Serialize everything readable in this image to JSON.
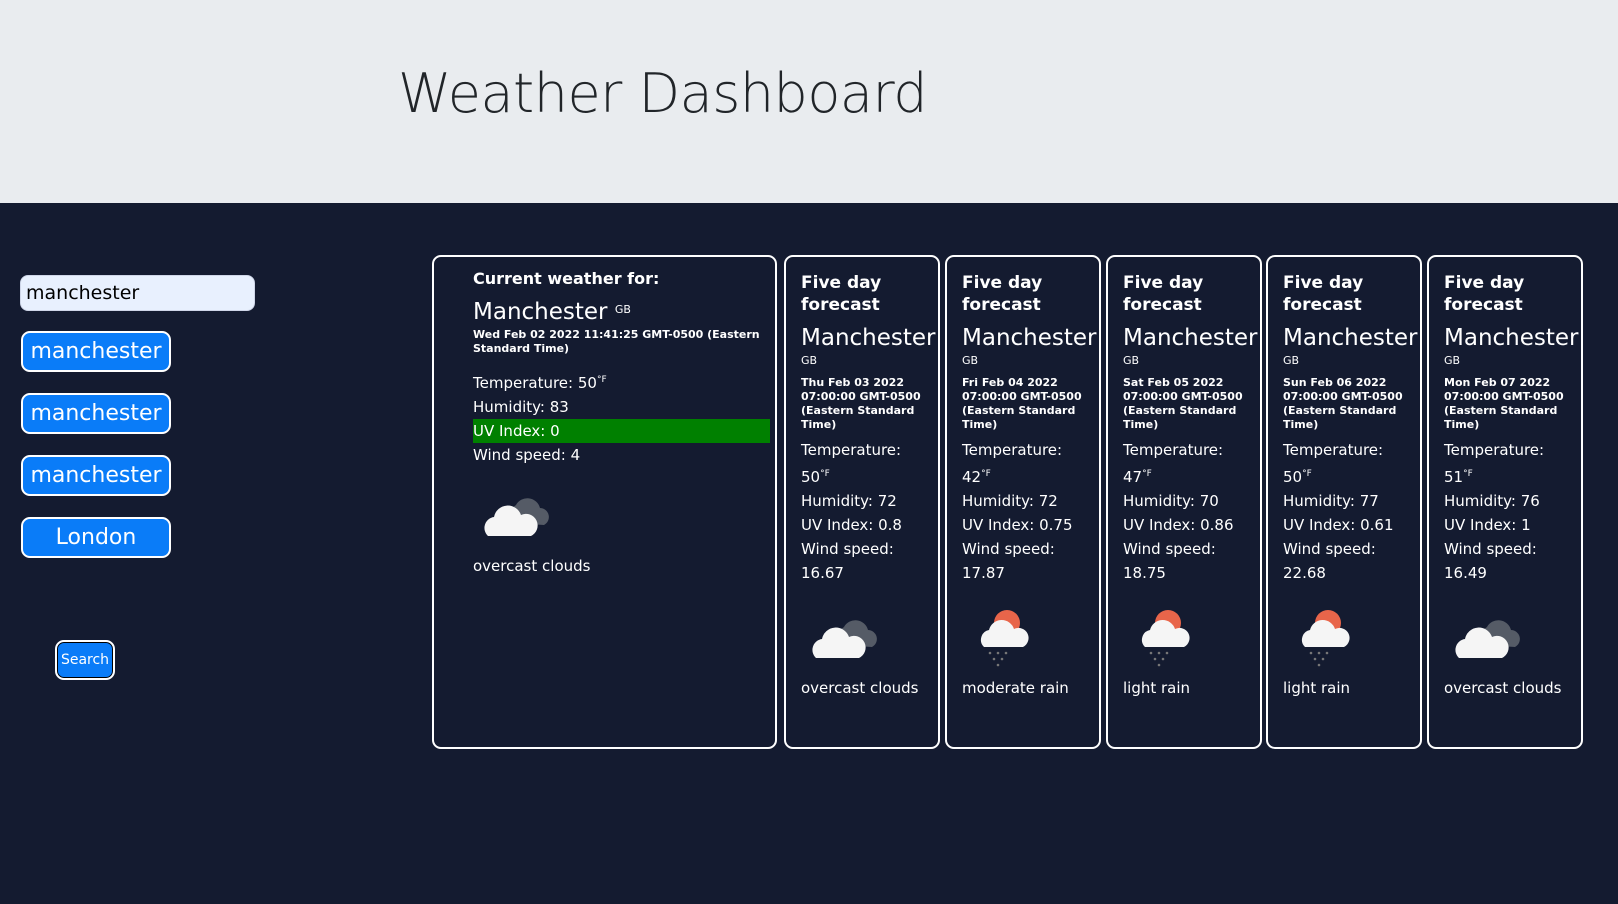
{
  "header": {
    "title": "Weather Dashboard"
  },
  "search": {
    "value": "manchester",
    "button_label": "Search"
  },
  "history": [
    "manchester",
    "manchester",
    "manchester",
    "London"
  ],
  "current": {
    "heading": "Current weather for:",
    "city": "Manchester",
    "country": "GB",
    "date": "Wed Feb 02 2022 11:41:25 GMT-0500 (Eastern Standard Time)",
    "temperature_label": "Temperature: 50",
    "temperature_unit": "°F",
    "humidity": "Humidity: 83",
    "uv": "UV Index: 0",
    "uv_color": "#008000",
    "wind": "Wind speed: 4",
    "icon": "overcast-clouds-icon",
    "description": "overcast clouds"
  },
  "forecast": [
    {
      "heading": "Five day forecast",
      "city": "Manchester",
      "country": "GB",
      "date": "Thu Feb 03 2022 07:00:00 GMT-0500 (Eastern Standard Time)",
      "temperature_label": "Temperature:",
      "temperature_value": "50",
      "temperature_unit": "°F",
      "humidity": "Humidity: 72",
      "uv": "UV Index: 0.8",
      "wind_label": "Wind speed:",
      "wind_value": "16.67",
      "icon": "overcast-clouds-icon",
      "description": "overcast clouds"
    },
    {
      "heading": "Five day forecast",
      "city": "Manchester",
      "country": "GB",
      "date": "Fri Feb 04 2022 07:00:00 GMT-0500 (Eastern Standard Time)",
      "temperature_label": "Temperature:",
      "temperature_value": "42",
      "temperature_unit": "°F",
      "humidity": "Humidity: 72",
      "uv": "UV Index: 0.75",
      "wind_label": "Wind speed:",
      "wind_value": "17.87",
      "icon": "rain-icon",
      "description": "moderate rain"
    },
    {
      "heading": "Five day forecast",
      "city": "Manchester",
      "country": "GB",
      "date": "Sat Feb 05 2022 07:00:00 GMT-0500 (Eastern Standard Time)",
      "temperature_label": "Temperature:",
      "temperature_value": "47",
      "temperature_unit": "°F",
      "humidity": "Humidity: 70",
      "uv": "UV Index: 0.86",
      "wind_label": "Wind speed:",
      "wind_value": "18.75",
      "icon": "rain-icon",
      "description": "light rain"
    },
    {
      "heading": "Five day forecast",
      "city": "Manchester",
      "country": "GB",
      "date": "Sun Feb 06 2022 07:00:00 GMT-0500 (Eastern Standard Time)",
      "temperature_label": "Temperature:",
      "temperature_value": "50",
      "temperature_unit": "°F",
      "humidity": "Humidity: 77",
      "uv": "UV Index: 0.61",
      "wind_label": "Wind speed:",
      "wind_value": "22.68",
      "icon": "rain-icon",
      "description": "light rain"
    },
    {
      "heading": "Five day forecast",
      "city": "Manchester",
      "country": "GB",
      "date": "Mon Feb 07 2022 07:00:00 GMT-0500 (Eastern Standard Time)",
      "temperature_label": "Temperature:",
      "temperature_value": "51",
      "temperature_unit": "°F",
      "humidity": "Humidity: 76",
      "uv": "UV Index: 1",
      "wind_label": "Wind speed:",
      "wind_value": "16.49",
      "icon": "overcast-clouds-icon",
      "description": "overcast clouds"
    }
  ],
  "colors": {
    "background": "#141b30",
    "header_bg": "#e9ecef",
    "button": "#0a7cf8"
  }
}
